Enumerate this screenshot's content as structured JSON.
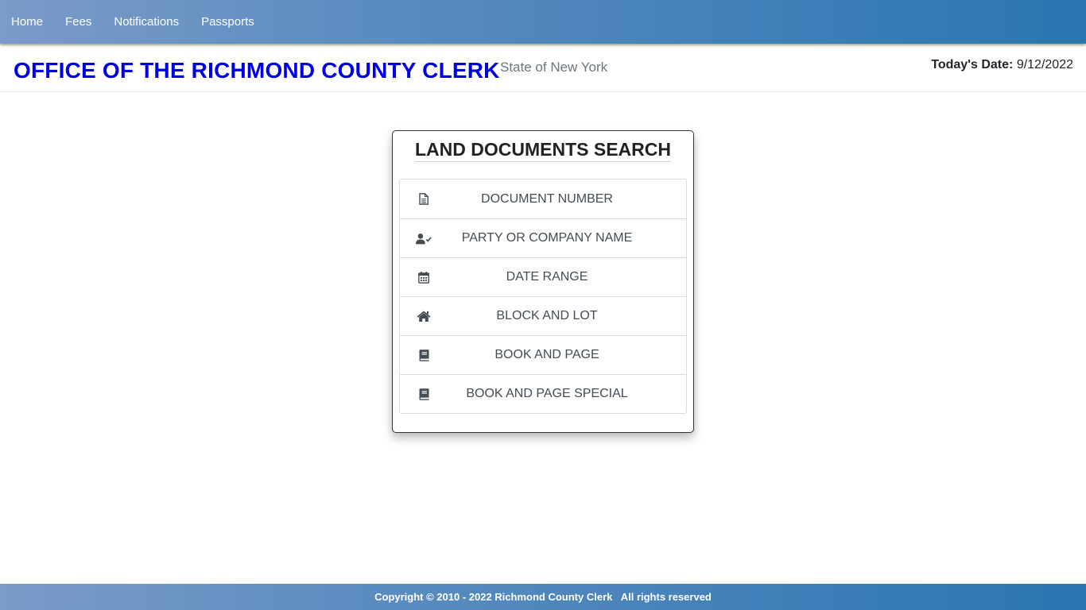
{
  "nav": {
    "items": [
      {
        "label": "Home"
      },
      {
        "label": "Fees"
      },
      {
        "label": "Notifications"
      },
      {
        "label": "Passports"
      }
    ]
  },
  "header": {
    "title": "OFFICE OF THE RICHMOND COUNTY CLERK",
    "subtitle": "State of New York",
    "date_label": "Today's Date:",
    "date_value": "9/12/2022"
  },
  "search": {
    "title": "LAND DOCUMENTS SEARCH",
    "options": [
      {
        "label": "DOCUMENT NUMBER",
        "icon": "document-icon"
      },
      {
        "label": "PARTY OR COMPANY NAME",
        "icon": "user-check-icon"
      },
      {
        "label": "DATE RANGE",
        "icon": "calendar-icon"
      },
      {
        "label": "BLOCK AND LOT",
        "icon": "home-icon"
      },
      {
        "label": "BOOK AND PAGE",
        "icon": "book-icon"
      },
      {
        "label": "BOOK AND PAGE SPECIAL",
        "icon": "book-icon"
      }
    ]
  },
  "footer": {
    "copyright": "Copyright © 2010 - 2022 Richmond County Clerk   All rights reserved"
  },
  "colors": {
    "title_blue": "#0000e6",
    "nav_gradient_start": "#7b9bc9",
    "nav_gradient_end": "#2a76b0",
    "icon_color": "#444c55"
  }
}
